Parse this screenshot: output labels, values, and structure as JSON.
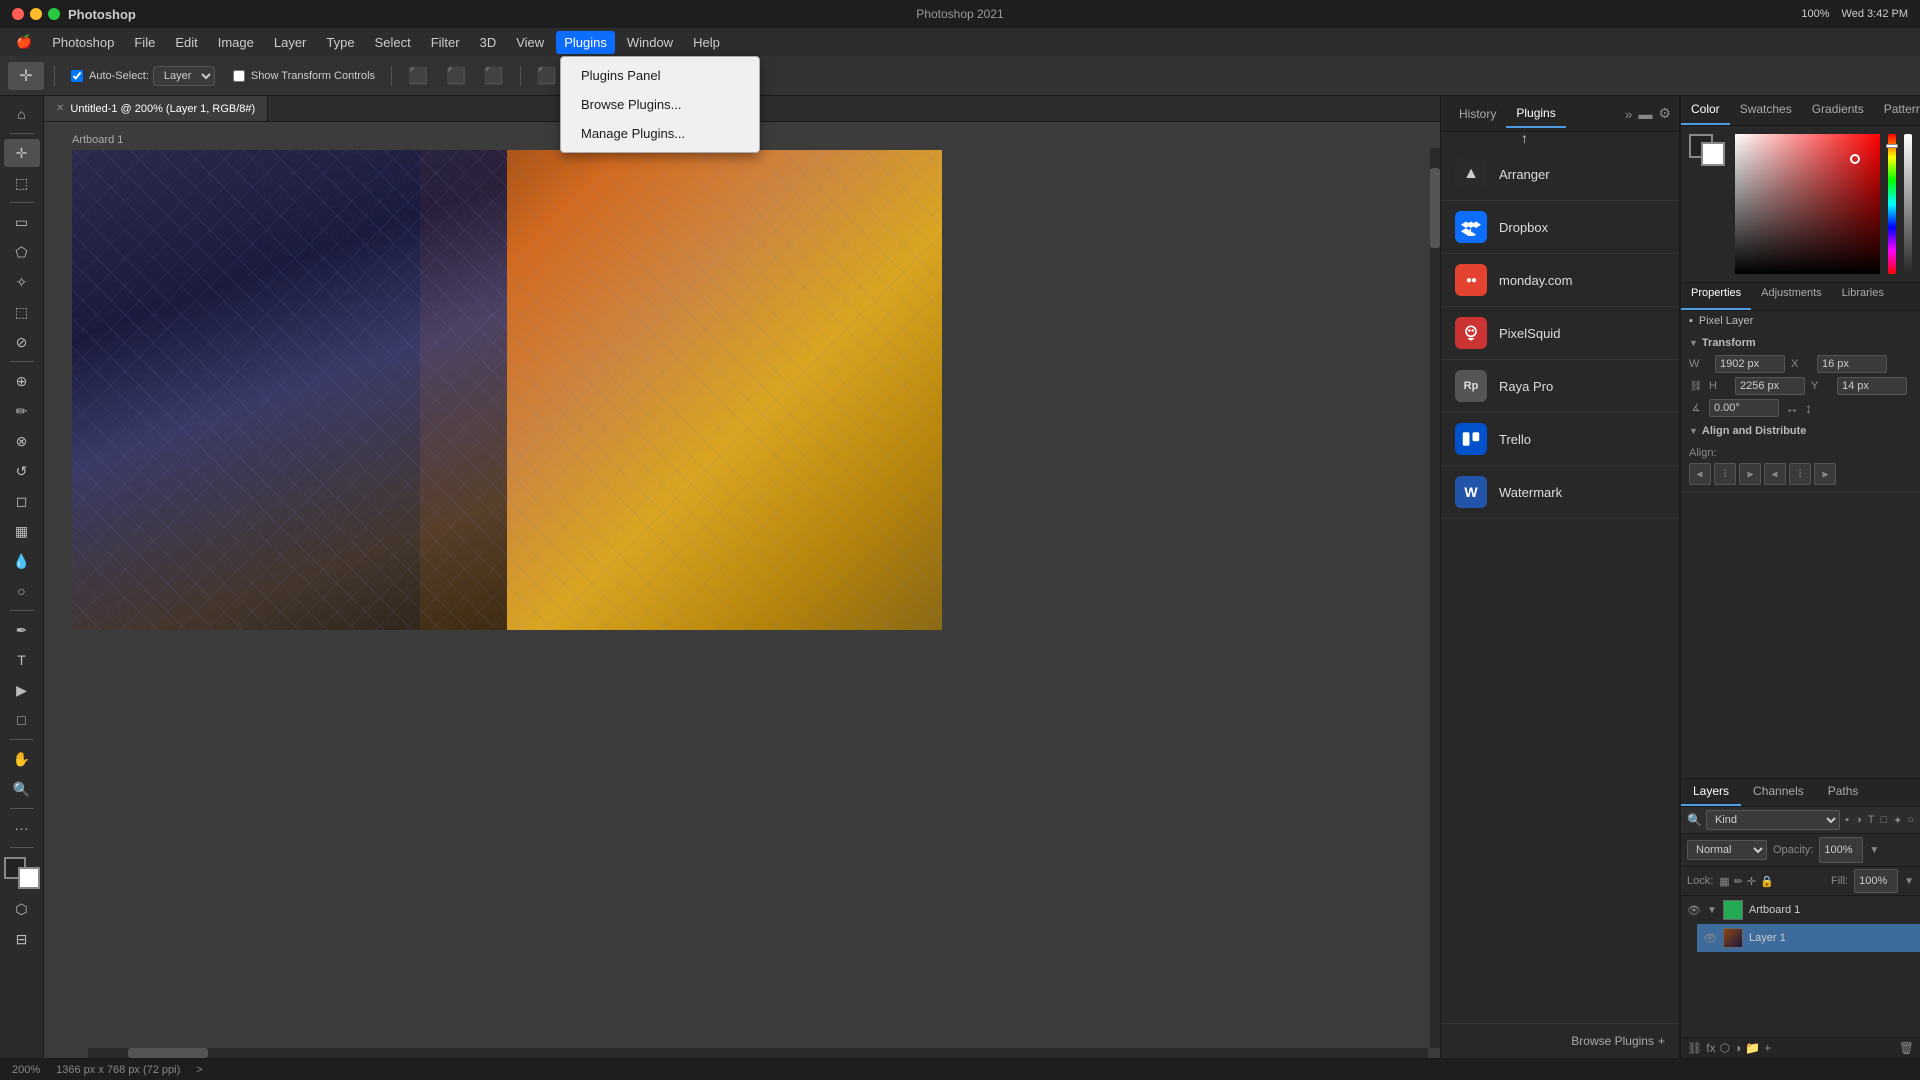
{
  "titleBar": {
    "appName": "Photoshop",
    "windowTitle": "Photoshop 2021",
    "time": "Wed 3:42 PM",
    "battery": "100%"
  },
  "menuBar": {
    "apple": "🍎",
    "items": [
      "Photoshop",
      "File",
      "Edit",
      "Image",
      "Layer",
      "Type",
      "Select",
      "Filter",
      "3D",
      "View",
      "Plugins",
      "Window",
      "Help"
    ]
  },
  "toolbar": {
    "autoSelect": "Auto-Select:",
    "layerOption": "Layer",
    "showTransformControls": "Show Transform Controls"
  },
  "document": {
    "tab": "Untitled-1 @ 200% (Layer 1, RGB/8#)",
    "artboardLabel": "Artboard 1"
  },
  "pluginsDropdown": {
    "items": [
      "Plugins Panel",
      "Browse Plugins...",
      "Manage Plugins..."
    ]
  },
  "pluginsPanel": {
    "tab1": "History",
    "tab2": "Plugins",
    "plugins": [
      {
        "name": "Arranger",
        "iconType": "arranger",
        "iconChar": "▲"
      },
      {
        "name": "Dropbox",
        "iconType": "dropbox",
        "iconChar": "❑"
      },
      {
        "name": "monday.com",
        "iconType": "monday",
        "iconChar": "●●"
      },
      {
        "name": "PixelSquid",
        "iconType": "pixelsquid",
        "iconChar": "P"
      },
      {
        "name": "Raya Pro",
        "iconType": "rayapro",
        "iconChar": "Rp"
      },
      {
        "name": "Trello",
        "iconType": "trello",
        "iconChar": "≡"
      },
      {
        "name": "Watermark",
        "iconType": "watermark",
        "iconChar": "W"
      }
    ],
    "browsePlugins": "Browse Plugins",
    "browseIcon": "+"
  },
  "colorPanel": {
    "tab1": "Color",
    "tab2": "Swatches",
    "tab3": "Gradients",
    "tab4": "Patterns"
  },
  "propertiesPanel": {
    "tab1": "Properties",
    "tab2": "Adjustments",
    "tab3": "Libraries",
    "pixelLayer": "Pixel Layer",
    "transform": {
      "title": "Transform",
      "w": "W: 1902 px",
      "h": "H: 2256 px",
      "x": "X: 16 px",
      "y": "Y: 14 px",
      "angle": "0.00°"
    },
    "alignDistribute": {
      "title": "Align and Distribute",
      "alignLabel": "Align:"
    }
  },
  "layersPanel": {
    "tab1": "Layers",
    "tab2": "Channels",
    "tab3": "Paths",
    "filterKind": "Kind",
    "blendMode": "Normal",
    "opacity": "100%",
    "lockLabel": "Lock:",
    "fill": "100%",
    "layers": [
      {
        "name": "Artboard 1",
        "type": "artboard",
        "visible": true,
        "expanded": true
      },
      {
        "name": "Layer 1",
        "type": "pixel",
        "visible": true
      }
    ]
  },
  "statusBar": {
    "zoom": "200%",
    "dimensions": "1366 px x 768 px (72 ppi)",
    "arrow": ">"
  }
}
